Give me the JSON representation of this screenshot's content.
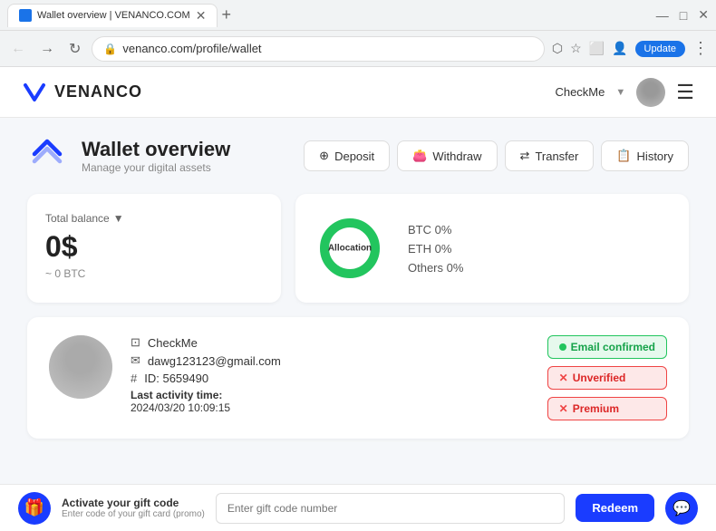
{
  "browser": {
    "tab_title": "Wallet overview | VENANCO.COM",
    "url": "venanco.com/profile/wallet",
    "update_label": "Update"
  },
  "header": {
    "logo_initial": "V",
    "logo_name": "VENANCO",
    "user_name": "CheckMe",
    "hamburger_label": "☰"
  },
  "wallet": {
    "title": "Wallet overview",
    "subtitle": "Manage your digital assets",
    "actions": {
      "deposit": "Deposit",
      "withdraw": "Withdraw",
      "transfer": "Transfer",
      "history": "History"
    }
  },
  "balance": {
    "label": "Total balance",
    "amount": "0$",
    "btc": "~ 0 BTC"
  },
  "allocation": {
    "center_label": "Allocation",
    "items": [
      {
        "label": "BTC 0%"
      },
      {
        "label": "ETH 0%"
      },
      {
        "label": "Others 0%"
      }
    ]
  },
  "profile": {
    "name": "CheckMe",
    "email": "dawg123123@gmail.com",
    "id": "ID: 5659490",
    "last_activity_label": "Last activity time:",
    "last_activity_time": "2024/03/20 10:09:15",
    "badges": {
      "email_confirmed": "Email confirmed",
      "unverified": "Unverified",
      "premium": "Premium"
    }
  },
  "bottom_bar": {
    "gift_title": "Activate your gift code",
    "gift_subtitle": "Enter code of your gift card (promo)",
    "input_placeholder": "Enter gift code number",
    "redeem_label": "Redeem"
  }
}
